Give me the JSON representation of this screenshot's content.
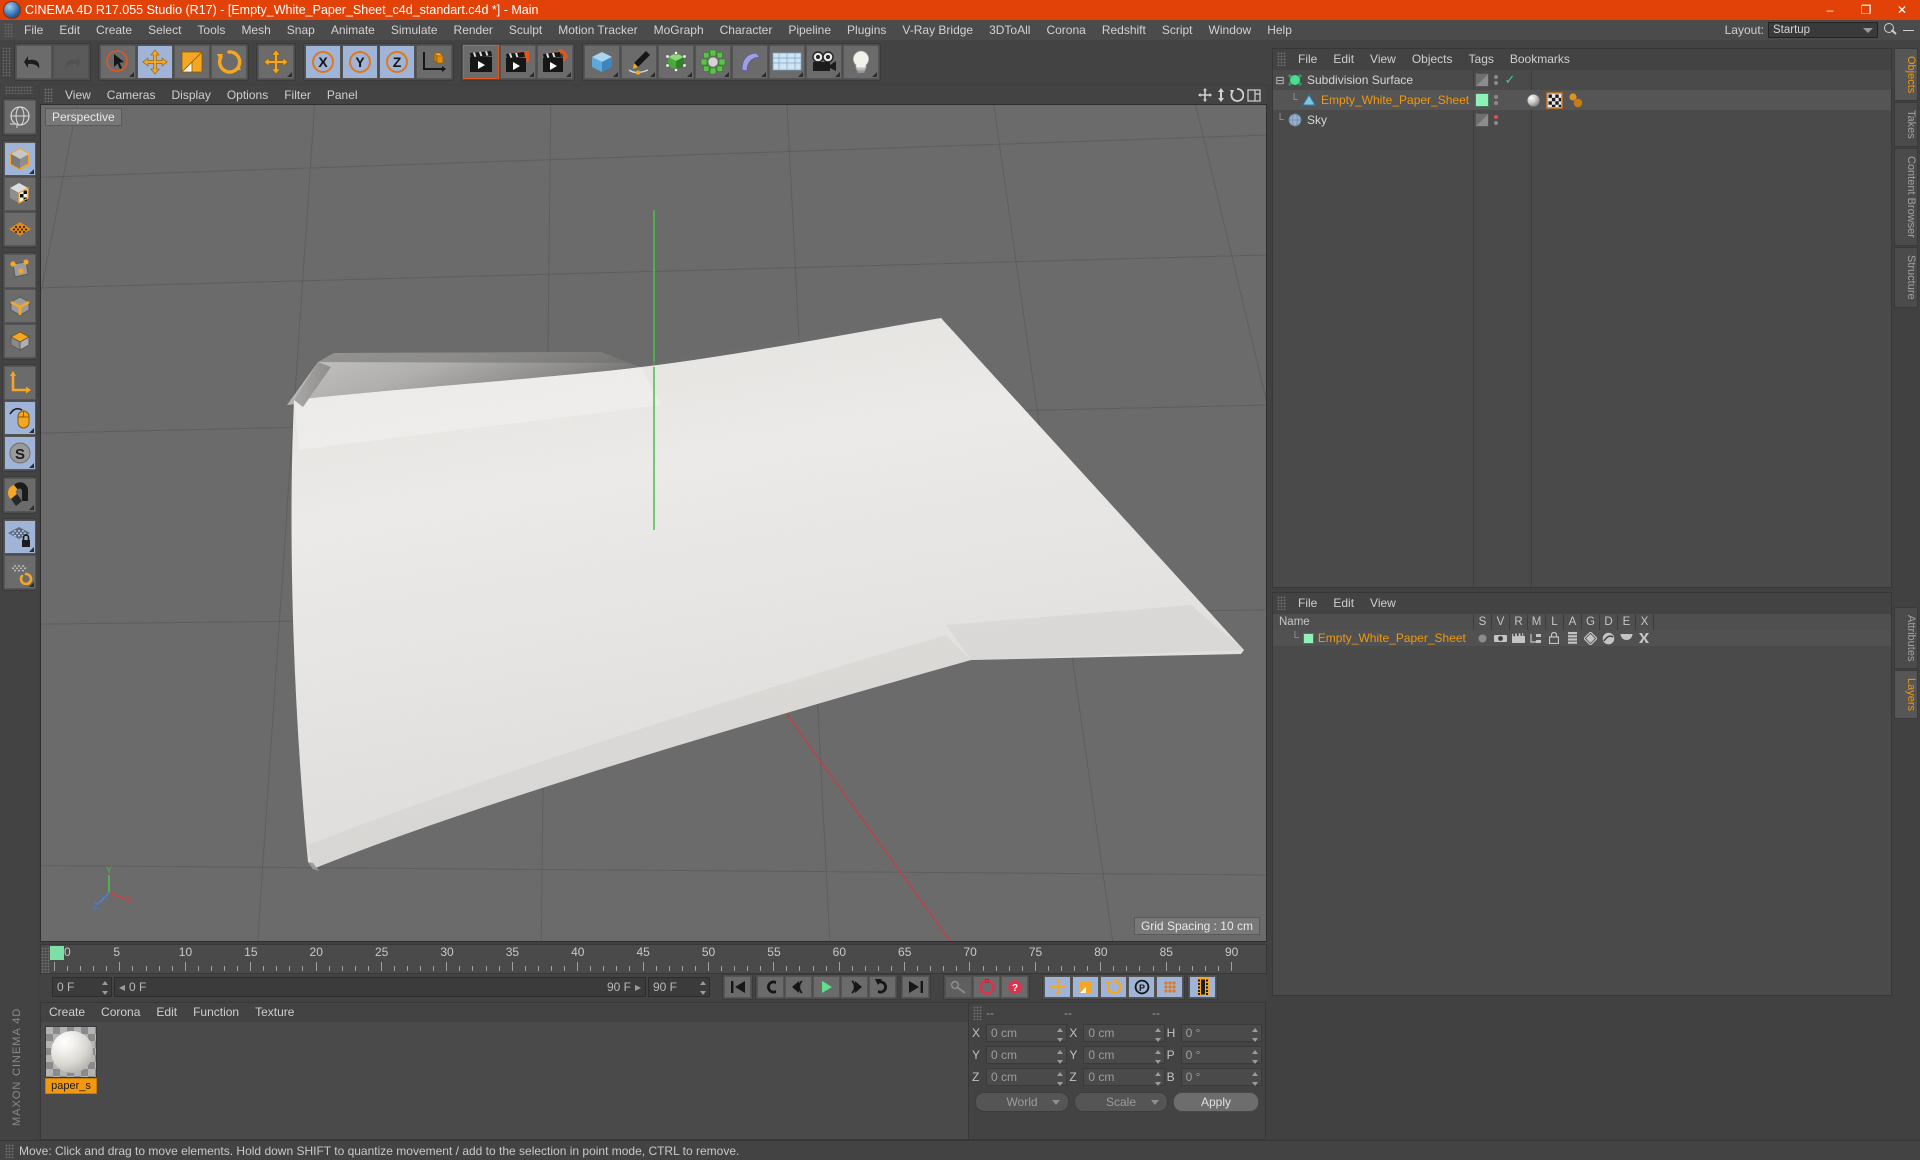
{
  "titlebar": {
    "title": "CINEMA 4D R17.055 Studio (R17) - [Empty_White_Paper_Sheet_c4d_standart.c4d *] - Main",
    "app_icon": "c4d-logo-icon",
    "minimize": "–",
    "maximize": "❐",
    "close": "✕",
    "accent": "#e24208"
  },
  "menubar": {
    "items": [
      "File",
      "Edit",
      "Create",
      "Select",
      "Tools",
      "Mesh",
      "Snap",
      "Animate",
      "Simulate",
      "Render",
      "Sculpt",
      "Motion Tracker",
      "MoGraph",
      "Character",
      "Pipeline",
      "Plugins",
      "V-Ray Bridge",
      "3DToAll",
      "Corona",
      "Redshift",
      "Script",
      "Window",
      "Help"
    ],
    "layout_label": "Layout:",
    "layout_value": "Startup",
    "search_icon": "magnifier-icon",
    "minimize_icon": "panel-minimize-icon"
  },
  "toolbar": {
    "groups": [
      {
        "name": "undo-redo",
        "buttons": [
          {
            "name": "undo-button",
            "icon": "undo-arrow-icon",
            "state": "normal"
          },
          {
            "name": "redo-button",
            "icon": "redo-arrow-icon",
            "state": "disabled"
          }
        ]
      },
      {
        "name": "transform-tools",
        "buttons": [
          {
            "name": "live-selection-tool",
            "icon": "cursor-circle-icon",
            "state": "normal"
          },
          {
            "name": "move-tool",
            "icon": "move-arrows-icon",
            "state": "active"
          },
          {
            "name": "scale-tool",
            "icon": "scale-box-icon",
            "state": "normal"
          },
          {
            "name": "rotate-tool",
            "icon": "rotate-circle-icon",
            "state": "normal"
          }
        ]
      },
      {
        "name": "global-move",
        "buttons": [
          {
            "name": "move-axis-tool",
            "icon": "move-arrows-icon",
            "state": "normal"
          }
        ]
      },
      {
        "name": "axis-locks",
        "buttons": [
          {
            "name": "lock-x-axis",
            "icon": "x-axis-icon",
            "state": "active"
          },
          {
            "name": "lock-y-axis",
            "icon": "y-axis-icon",
            "state": "active"
          },
          {
            "name": "lock-z-axis",
            "icon": "z-axis-icon",
            "state": "active"
          },
          {
            "name": "world-object-coord",
            "icon": "world-axis-cube-icon",
            "state": "normal"
          }
        ]
      },
      {
        "name": "render-group",
        "buttons": [
          {
            "name": "render-view-button",
            "icon": "clapper-view-icon",
            "state": "selected"
          },
          {
            "name": "render-to-picture-viewer-button",
            "icon": "clapper-picture-icon",
            "state": "normal"
          },
          {
            "name": "render-settings-button",
            "icon": "clapper-gear-icon",
            "state": "normal"
          }
        ]
      },
      {
        "name": "create-group",
        "buttons": [
          {
            "name": "add-cube-button",
            "icon": "blue-cube-icon",
            "state": "normal"
          },
          {
            "name": "add-spline-button",
            "icon": "pen-spline-icon",
            "state": "normal"
          },
          {
            "name": "add-nurbs-button",
            "icon": "green-nurbs-icon",
            "state": "normal"
          },
          {
            "name": "add-array-button",
            "icon": "green-array-icon",
            "state": "normal"
          },
          {
            "name": "add-deformer-button",
            "icon": "bend-deformer-icon",
            "state": "normal"
          },
          {
            "name": "add-floor-button",
            "icon": "floor-grid-icon",
            "state": "normal"
          },
          {
            "name": "add-camera-button",
            "icon": "camera-icon",
            "state": "normal"
          },
          {
            "name": "add-light-button",
            "icon": "lightbulb-icon",
            "state": "normal"
          }
        ]
      }
    ]
  },
  "left_palette": {
    "groups": [
      {
        "name": "navigation",
        "buttons": [
          {
            "name": "undo-view-button",
            "icon": "globe-wire-icon",
            "state": "normal"
          }
        ]
      },
      {
        "name": "editing-modes",
        "buttons": [
          {
            "name": "make-editable-button",
            "icon": "editable-cube-icon",
            "state": "active"
          },
          {
            "name": "texture-mode-button",
            "icon": "checker-cube-icon",
            "state": "normal"
          },
          {
            "name": "viewport-solo-button",
            "icon": "orange-grid-icon",
            "state": "normal"
          }
        ]
      },
      {
        "name": "component-modes",
        "buttons": [
          {
            "name": "point-mode-button",
            "icon": "point-cube-icon",
            "state": "normal"
          },
          {
            "name": "edge-mode-button",
            "icon": "edge-cube-icon",
            "state": "normal"
          },
          {
            "name": "polygon-mode-button",
            "icon": "polygon-cube-icon",
            "state": "normal"
          }
        ]
      },
      {
        "name": "axis-tools",
        "buttons": [
          {
            "name": "enable-axis-button",
            "icon": "axis-l-icon",
            "state": "normal"
          },
          {
            "name": "viewport-solo-single-button",
            "icon": "mouse-icon",
            "state": "active"
          },
          {
            "name": "soft-selection-button",
            "icon": "s-circle-icon",
            "state": "active"
          }
        ]
      },
      {
        "name": "snapping",
        "buttons": [
          {
            "name": "enable-snap-button",
            "icon": "magnet-icon",
            "state": "normal"
          }
        ]
      },
      {
        "name": "workplane",
        "buttons": [
          {
            "name": "lock-workplane-button",
            "icon": "grid-lock-icon",
            "state": "active"
          },
          {
            "name": "planar-workplane-button",
            "icon": "grid-rotate-icon",
            "state": "normal"
          }
        ]
      }
    ],
    "brand_primary": "MAXON",
    "brand_secondary": "CINEMA 4D"
  },
  "viewport": {
    "menu_items": [
      "View",
      "Cameras",
      "Display",
      "Options",
      "Filter",
      "Panel"
    ],
    "view_label": "Perspective",
    "grid_spacing": "Grid Spacing : 10 cm",
    "corner_icons": [
      {
        "name": "viewport-move-icon",
        "icon": "move-arrows-icon"
      },
      {
        "name": "viewport-scale-icon",
        "icon": "up-down-arrow-icon"
      },
      {
        "name": "viewport-rotate-icon",
        "icon": "rotate-circle-icon"
      },
      {
        "name": "viewport-maximize-icon",
        "icon": "maximize-panel-icon"
      }
    ],
    "axis_labels": {
      "y": "Y",
      "x": "X",
      "z": "Z"
    },
    "background": "#6b6b6b",
    "object_name": "white paper sheet"
  },
  "timeline": {
    "ticks": [
      {
        "label": "0",
        "frame": 0
      },
      {
        "label": "5",
        "frame": 5
      },
      {
        "label": "10",
        "frame": 10
      },
      {
        "label": "15",
        "frame": 15
      },
      {
        "label": "20",
        "frame": 20
      },
      {
        "label": "25",
        "frame": 25
      },
      {
        "label": "30",
        "frame": 30
      },
      {
        "label": "35",
        "frame": 35
      },
      {
        "label": "40",
        "frame": 40
      },
      {
        "label": "45",
        "frame": 45
      },
      {
        "label": "50",
        "frame": 50
      },
      {
        "label": "55",
        "frame": 55
      },
      {
        "label": "60",
        "frame": 60
      },
      {
        "label": "65",
        "frame": 65
      },
      {
        "label": "70",
        "frame": 70
      },
      {
        "label": "75",
        "frame": 75
      },
      {
        "label": "80",
        "frame": 80
      },
      {
        "label": "85",
        "frame": 85
      },
      {
        "label": "90",
        "frame": 90
      }
    ],
    "range_min": 0,
    "range_max": 90,
    "current_frame_field": "0 F",
    "current_frame_right": "0 F",
    "range_start_field": "0 F",
    "range_end_field": "90 F",
    "preview_end_field": "90 F",
    "transport": [
      {
        "name": "go-to-start-button",
        "icon": "skip-start-icon"
      },
      {
        "name": "play-backwards-button",
        "icon": "play-back-icon"
      },
      {
        "name": "previous-frame-button",
        "icon": "step-back-icon"
      },
      {
        "name": "play-forward-button",
        "icon": "play-icon"
      },
      {
        "name": "next-frame-button",
        "icon": "step-forward-icon"
      },
      {
        "name": "play-loop-button",
        "icon": "loop-icon"
      },
      {
        "name": "go-to-end-button",
        "icon": "skip-end-icon"
      }
    ],
    "record_group": [
      {
        "name": "autokeying-button",
        "icon": "key-icon"
      },
      {
        "name": "record-active-objects-button",
        "icon": "record-circle-icon"
      },
      {
        "name": "auto-keying-toggle-button",
        "icon": "question-circle-icon"
      }
    ],
    "key_group": [
      {
        "name": "key-position-button",
        "icon": "move-arrows-icon"
      },
      {
        "name": "key-scale-button",
        "icon": "scale-box-icon"
      },
      {
        "name": "key-rotation-button",
        "icon": "rotate-circle-icon"
      },
      {
        "name": "key-parameter-button",
        "icon": "p-circle-icon"
      },
      {
        "name": "key-point-level-button",
        "icon": "dots-grid-icon"
      },
      {
        "name": "timeline-film-button",
        "icon": "film-strip-icon"
      }
    ]
  },
  "material_manager": {
    "menu_items": [
      "Create",
      "Corona",
      "Edit",
      "Function",
      "Texture"
    ],
    "materials": [
      {
        "name": "paper_s",
        "preview": "white-glossy-sphere"
      }
    ]
  },
  "coordinates": {
    "header_cells": [
      "--",
      "--",
      "--"
    ],
    "rows": [
      {
        "pos_label": "X",
        "pos_value": "0 cm",
        "size_label": "X",
        "size_value": "0 cm",
        "rot_label": "H",
        "rot_value": "0 °"
      },
      {
        "pos_label": "Y",
        "pos_value": "0 cm",
        "size_label": "Y",
        "size_value": "0 cm",
        "rot_label": "P",
        "rot_value": "0 °"
      },
      {
        "pos_label": "Z",
        "pos_value": "0 cm",
        "size_label": "Z",
        "size_value": "0 cm",
        "rot_label": "B",
        "rot_value": "0 °"
      }
    ],
    "system_select": "World",
    "mode_select": "Scale",
    "apply_button": "Apply"
  },
  "object_manager": {
    "menu_items": [
      "File",
      "Edit",
      "View",
      "Objects",
      "Tags",
      "Bookmarks"
    ],
    "rows": [
      {
        "name": "Subdivision Surface",
        "icon": "subdivision-surface-icon",
        "indent": 0,
        "selected": false,
        "visibility_check": true,
        "dot_color": "#8a8a8a",
        "tags": []
      },
      {
        "name": "Empty_White_Paper_Sheet",
        "icon": "polygon-object-icon",
        "indent": 1,
        "selected": true,
        "visibility_check": false,
        "swatch": "#8ff0b8",
        "dot_color": "#8a8a8a",
        "tags": [
          "material-tag-icon",
          "uvw-tag-icon",
          "phong-tag-icon"
        ]
      },
      {
        "name": "Sky",
        "icon": "sky-object-icon",
        "indent": 0,
        "selected": false,
        "visibility_check": false,
        "dot_color": "#e05050",
        "tags": []
      }
    ]
  },
  "layer_manager": {
    "menu_items": [
      "File",
      "Edit",
      "View"
    ],
    "columns": [
      "Name",
      "S",
      "V",
      "R",
      "M",
      "L",
      "A",
      "G",
      "D",
      "E",
      "X"
    ],
    "rows": [
      {
        "name": "Empty_White_Paper_Sheet",
        "swatch": "#8ff0b8",
        "icons": [
          "solo-dot-icon",
          "view-icon",
          "render-icon",
          "manager-icon",
          "lock-icon",
          "animation-icon",
          "generator-icon",
          "deformer-icon",
          "expression-icon",
          "xref-icon"
        ]
      }
    ]
  },
  "right_tabs": {
    "top": [
      {
        "label": "Objects",
        "active": true
      },
      {
        "label": "Takes",
        "active": false
      },
      {
        "label": "Content Browser",
        "active": false
      },
      {
        "label": "Structure",
        "active": false
      }
    ],
    "bottom": [
      {
        "label": "Attributes",
        "active": false
      },
      {
        "label": "Layers",
        "active": true
      }
    ]
  },
  "statusbar": {
    "text": "Move: Click and drag to move elements. Hold down SHIFT to quantize movement / add to the selection in point mode, CTRL to remove."
  }
}
